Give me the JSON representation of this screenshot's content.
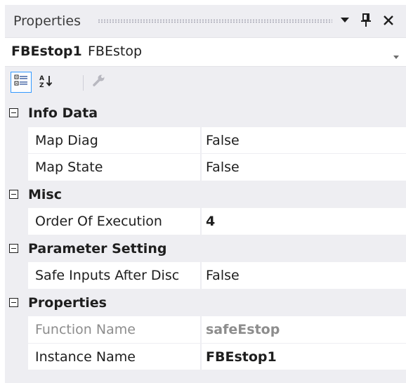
{
  "window": {
    "title": "Properties"
  },
  "object_selector": {
    "name": "FBEstop1",
    "type": "FBEstop"
  },
  "toolbar": {
    "icons": [
      "categorized-icon",
      "alphabetical-icon",
      "property-pages-icon"
    ],
    "active": "categorized"
  },
  "categories": [
    {
      "label": "Info Data",
      "properties": [
        {
          "name": "Map Diag",
          "value": "False"
        },
        {
          "name": "Map State",
          "value": "False"
        }
      ]
    },
    {
      "label": "Misc",
      "properties": [
        {
          "name": "Order Of Execution",
          "value": "4"
        }
      ]
    },
    {
      "label": "Parameter Setting",
      "properties": [
        {
          "name": "Safe Inputs After Disc",
          "value": "False"
        }
      ]
    },
    {
      "label": "Properties",
      "properties": [
        {
          "name": "Function Name",
          "value": "safeEstop"
        },
        {
          "name": "Instance Name",
          "value": "FBEstop1"
        }
      ]
    }
  ],
  "colors": {
    "panel_bg": "#eeeef2",
    "active_border": "#3399ff",
    "readonly_text": "#8d8d8d"
  }
}
